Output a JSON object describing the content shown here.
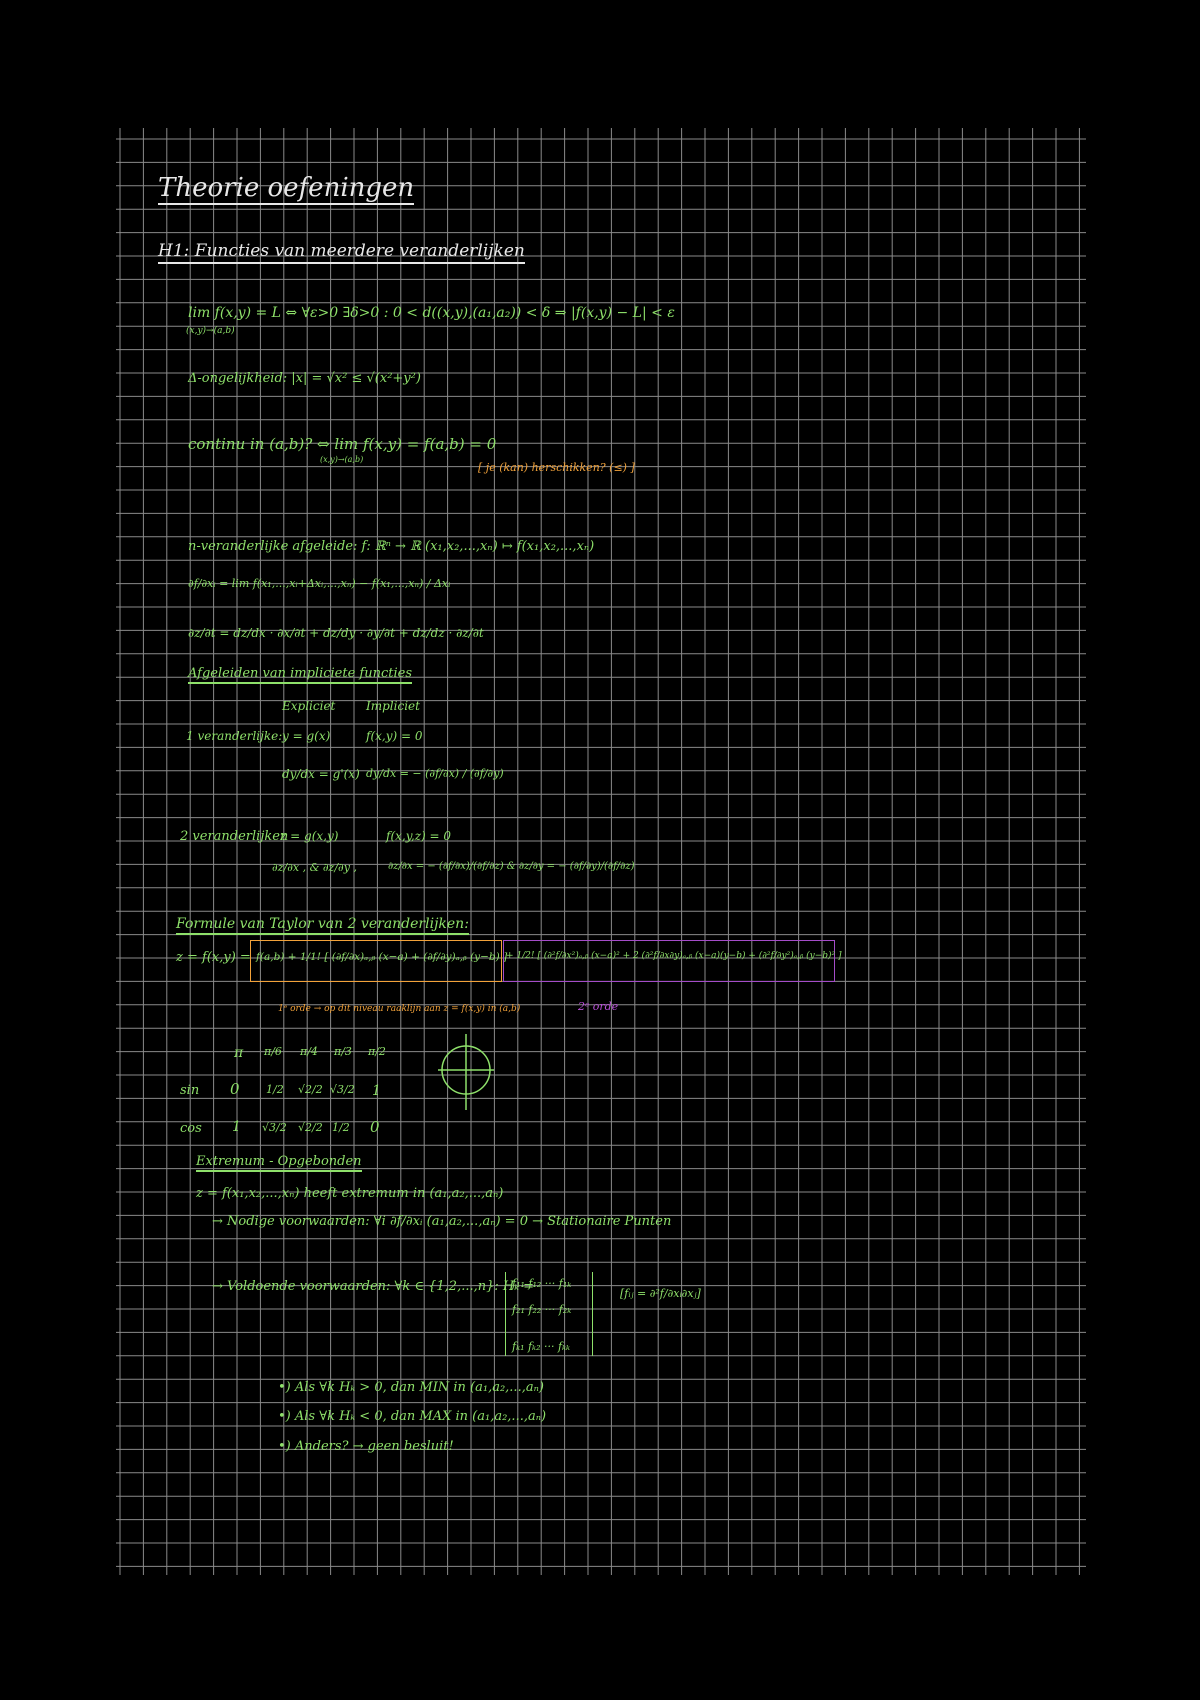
{
  "page": {
    "title": "Theorie oefeningen",
    "chapter": "H1: Functies van meerdere veranderlijken"
  },
  "notes": {
    "limit_def": "lim f(x,y) = L ⇔ ∀ε>0 ∃δ>0 : 0 < d((x,y),(a₁,a₂)) < δ ⇒ |f(x,y) − L| < ε",
    "limit_sub": "(x,y)→(a,b)",
    "triangle_ineq": "Δ-ongelijkheid: |x| = √x² ≤ √(x²+y²)",
    "continuity": "continu in (a,b)? ⇔ lim f(x,y) = f(a,b) = 0",
    "continuity_sub": "(x,y)→(a,b)",
    "continuity_note": "[ je (kan) herschikken? (≤) ]",
    "n_var_deriv": "n-veranderlijke afgeleide: f: ℝⁿ → ℝ (x₁,x₂,...,xₙ) ↦ f(x₁,x₂,...,xₙ)",
    "partial_def": "∂f/∂xᵢ = lim f(x₁,...,xᵢ+Δxᵢ,...,xₙ) − f(x₁,...,xₙ) / Δxᵢ",
    "chain_rule": "∂z/∂t = dz/dx · ∂x/∂t + dz/dy · ∂y/∂t + dz/dz · ∂z/∂t",
    "implicit_title": "Afgeleiden van impliciete functies",
    "col_explicit": "Expliciet",
    "col_implicit": "Impliciet",
    "one_var_label": "1 veranderlijke:",
    "one_var_explicit": "y = g(x)",
    "one_var_implicit": "f(x,y) = 0",
    "one_var_explicit_deriv": "dy/dx = g'(x)",
    "one_var_implicit_deriv": "dy/dx = − (∂f/∂x) / (∂f/∂y)",
    "two_var_label": "2 veranderlijken",
    "two_var_explicit": "z = g(x,y)",
    "two_var_implicit": "f(x,y,z) = 0",
    "two_var_explicit_deriv": "∂z/∂x , & ∂z/∂y ,",
    "two_var_implicit_deriv": "∂z/∂x = − (∂f/∂x)/(∂f/∂z)  &  ∂z/∂y = − (∂f/∂y)/(∂f/∂z)",
    "taylor_title": "Formule van Taylor van 2 veranderlijken:",
    "taylor_lhs": "z = f(x,y) =",
    "taylor_first": "f(a,b) + 1/1! [ (∂f/∂x)ₐ,ᵦ (x−a) + (∂f/∂y)ₐ,ᵦ (y−b) ]",
    "taylor_second": "+ 1/2! [ (∂²f/∂x²)ₐ,ᵦ (x−a)² + 2 (∂²f/∂x∂y)ₐ,ᵦ (x−a)(y−b) + (∂²f/∂y²)ₐ,ᵦ (y−b)² ]",
    "taylor_note_orange": "1ᵉ orde → op dit niveau raaklijn aan z = f(x,y) in (a,b)",
    "taylor_note_purple": "2ᵉ orde",
    "unit_angles": [
      "π",
      "π/6",
      "π/4",
      "π/3",
      "π/2"
    ],
    "unit_sin_label": "sin",
    "unit_sin": [
      "0",
      "1/2",
      "√2/2",
      "√3/2",
      "1"
    ],
    "unit_cos_label": "cos",
    "unit_cos": [
      "1",
      "√3/2",
      "√2/2",
      "1/2",
      "0"
    ],
    "extrema_title": "Extremum - Opgebonden",
    "extrema_def": "z = f(x₁,x₂,...,xₙ) heeft extremum in (a₁,a₂,...,aₙ)",
    "extrema_necessary": "→ Nodige voorwaarden: ∀i ∂f/∂xᵢ (a₁,a₂,...,aₙ) = 0  →  Stationaire Punten",
    "extrema_sufficient": "→ Voldoende voorwaarden: ∀k ∈ {1,2,...,n}: Hₖ =",
    "hessian_rows": [
      "f₁₁ f₁₂ ··· f₁ₖ",
      "f₂₁ f₂₂ ··· f₂ₖ",
      "fₖ₁ fₖ₂ ··· fₖₖ"
    ],
    "hessian_note": "[fᵢⱼ = ∂²f/∂xᵢ∂xⱼ]",
    "cond_min": "•) Als ∀k Hₖ > 0, dan MIN in (a₁,a₂,...,aₙ)",
    "cond_max": "•) Als ∀k Hₖ < 0, dan MAX in (a₁,a₂,...,aₙ)",
    "cond_else": "•) Anders? → geen besluit!"
  },
  "colors": {
    "background": "#000000",
    "grid": "#8a8a8a",
    "text_white": "#e8e8e8",
    "text_green": "#8ee06a",
    "text_orange": "#f2a23a",
    "text_purple": "#b84fd8"
  }
}
